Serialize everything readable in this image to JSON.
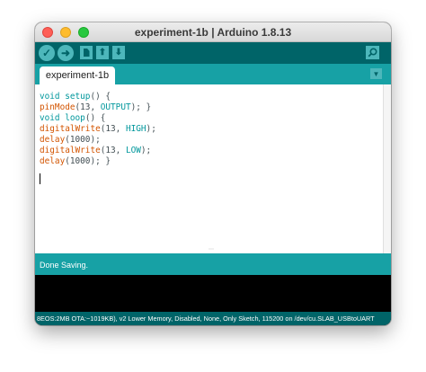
{
  "window": {
    "title": "experiment-1b | Arduino 1.8.13"
  },
  "toolbar": {
    "verify_icon": "check-icon",
    "upload_icon": "arrow-right-icon",
    "new_icon": "new-file-icon",
    "open_icon": "arrow-up-icon",
    "save_icon": "arrow-down-icon",
    "serial_monitor_icon": "magnifier-icon"
  },
  "tabs": [
    {
      "label": "experiment-1b",
      "active": true
    }
  ],
  "editor": {
    "lines": [
      [
        {
          "t": "void",
          "c": "kw"
        },
        {
          "t": " ",
          "c": "txt"
        },
        {
          "t": "setup",
          "c": "kw"
        },
        {
          "t": "() {",
          "c": "txt"
        }
      ],
      [
        {
          "t": "pinMode",
          "c": "fn"
        },
        {
          "t": "(13, ",
          "c": "txt"
        },
        {
          "t": "OUTPUT",
          "c": "cst"
        },
        {
          "t": "); }",
          "c": "txt"
        }
      ],
      [
        {
          "t": "void",
          "c": "kw"
        },
        {
          "t": " ",
          "c": "txt"
        },
        {
          "t": "loop",
          "c": "kw"
        },
        {
          "t": "() {",
          "c": "txt"
        }
      ],
      [
        {
          "t": "digitalWrite",
          "c": "fn"
        },
        {
          "t": "(13, ",
          "c": "txt"
        },
        {
          "t": "HIGH",
          "c": "cst"
        },
        {
          "t": ");",
          "c": "txt"
        }
      ],
      [
        {
          "t": "delay",
          "c": "fn"
        },
        {
          "t": "(1000);",
          "c": "txt"
        }
      ],
      [
        {
          "t": "digitalWrite",
          "c": "fn"
        },
        {
          "t": "(13, ",
          "c": "txt"
        },
        {
          "t": "LOW",
          "c": "cst"
        },
        {
          "t": ");",
          "c": "txt"
        }
      ],
      [
        {
          "t": "delay",
          "c": "fn"
        },
        {
          "t": "(1000); }",
          "c": "txt"
        }
      ]
    ]
  },
  "status": {
    "message": "Done Saving."
  },
  "footer": {
    "board_info": "8EOS:2MB OTA:~1019KB), v2 Lower Memory, Disabled, None, Only Sketch, 115200 on /dev/cu.SLAB_USBtoUART"
  },
  "colors": {
    "toolbar": "#006468",
    "tabbar": "#17a1a5",
    "button": "#4db7bb",
    "keyword": "#00979c",
    "function": "#d35400"
  }
}
